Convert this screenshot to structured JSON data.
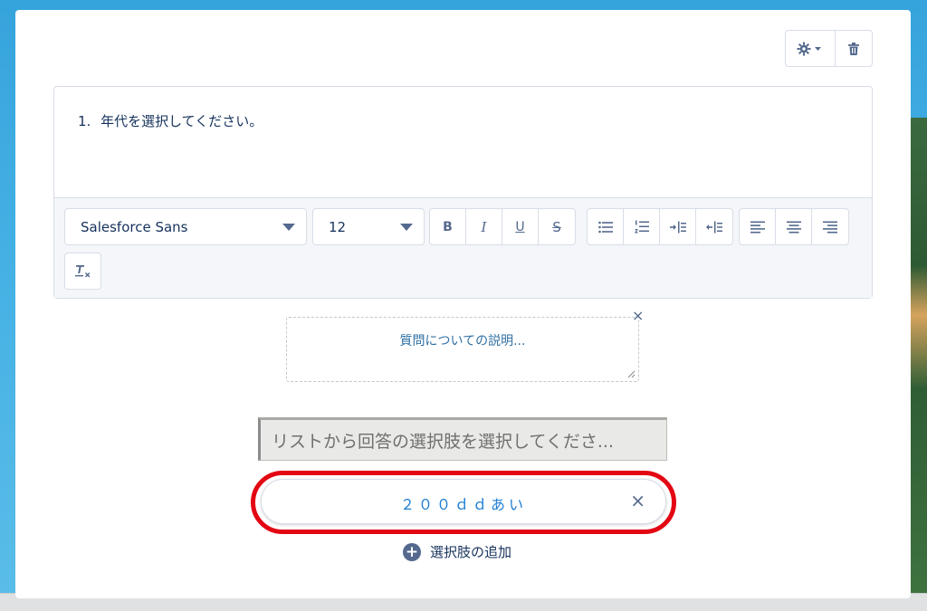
{
  "question": {
    "number": "1.",
    "text": "年代を選択してください。"
  },
  "toolbar": {
    "font_family": "Salesforce Sans",
    "font_size": "12",
    "format_buttons": [
      "B",
      "I",
      "U",
      "S"
    ]
  },
  "description": {
    "placeholder": "質問についての説明...",
    "close": "×"
  },
  "picklist": {
    "placeholder": "リストから回答の選択肢を選択してくださ..."
  },
  "choice": {
    "value": "２００ｄｄあい",
    "remove": "×"
  },
  "add_choice": {
    "icon": "+",
    "label": "選択肢の追加"
  },
  "icons": {
    "settings": "gear-icon",
    "delete": "trash-icon"
  },
  "colors": {
    "highlight": "#e30613",
    "link": "#1e7fd2",
    "text": "#16325c"
  }
}
